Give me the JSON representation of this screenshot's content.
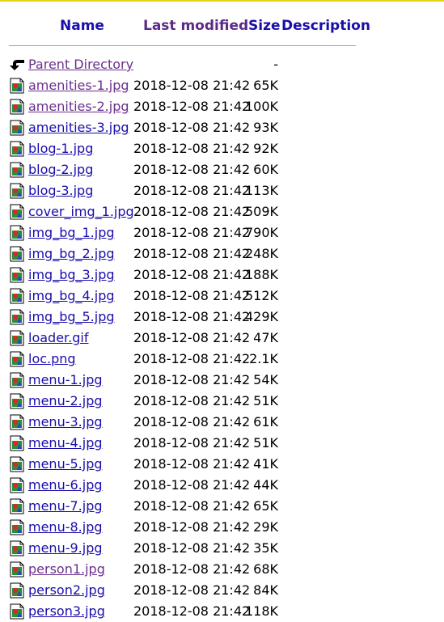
{
  "colors": {
    "link": "#1a0dab",
    "visited": "#6b2f8e",
    "top_bar": "#e5d319"
  },
  "header": {
    "name": "Name",
    "last_modified": "Last modified",
    "size": "Size",
    "description": "Description"
  },
  "parent": {
    "label": "Parent Directory",
    "size": "-",
    "icon": "back-arrow-icon"
  },
  "files": [
    {
      "name": "amenities-1.jpg",
      "date": "2018-12-08 21:42",
      "size": "65K",
      "visited": true
    },
    {
      "name": "amenities-2.jpg",
      "date": "2018-12-08 21:42",
      "size": "100K",
      "visited": true
    },
    {
      "name": "amenities-3.jpg",
      "date": "2018-12-08 21:42",
      "size": "93K",
      "visited": false
    },
    {
      "name": "blog-1.jpg",
      "date": "2018-12-08 21:42",
      "size": "92K",
      "visited": false
    },
    {
      "name": "blog-2.jpg",
      "date": "2018-12-08 21:42",
      "size": "60K",
      "visited": false
    },
    {
      "name": "blog-3.jpg",
      "date": "2018-12-08 21:42",
      "size": "113K",
      "visited": false
    },
    {
      "name": "cover_img_1.jpg",
      "date": "2018-12-08 21:42",
      "size": "509K",
      "visited": false
    },
    {
      "name": "img_bg_1.jpg",
      "date": "2018-12-08 21:42",
      "size": "790K",
      "visited": false
    },
    {
      "name": "img_bg_2.jpg",
      "date": "2018-12-08 21:42",
      "size": "248K",
      "visited": false
    },
    {
      "name": "img_bg_3.jpg",
      "date": "2018-12-08 21:42",
      "size": "188K",
      "visited": false
    },
    {
      "name": "img_bg_4.jpg",
      "date": "2018-12-08 21:42",
      "size": "512K",
      "visited": false
    },
    {
      "name": "img_bg_5.jpg",
      "date": "2018-12-08 21:42",
      "size": "429K",
      "visited": false
    },
    {
      "name": "loader.gif",
      "date": "2018-12-08 21:42",
      "size": "47K",
      "visited": false
    },
    {
      "name": "loc.png",
      "date": "2018-12-08 21:42",
      "size": "2.1K",
      "visited": false
    },
    {
      "name": "menu-1.jpg",
      "date": "2018-12-08 21:42",
      "size": "54K",
      "visited": false
    },
    {
      "name": "menu-2.jpg",
      "date": "2018-12-08 21:42",
      "size": "51K",
      "visited": false
    },
    {
      "name": "menu-3.jpg",
      "date": "2018-12-08 21:42",
      "size": "61K",
      "visited": false
    },
    {
      "name": "menu-4.jpg",
      "date": "2018-12-08 21:42",
      "size": "51K",
      "visited": false
    },
    {
      "name": "menu-5.jpg",
      "date": "2018-12-08 21:42",
      "size": "41K",
      "visited": false
    },
    {
      "name": "menu-6.jpg",
      "date": "2018-12-08 21:42",
      "size": "44K",
      "visited": false
    },
    {
      "name": "menu-7.jpg",
      "date": "2018-12-08 21:42",
      "size": "65K",
      "visited": false
    },
    {
      "name": "menu-8.jpg",
      "date": "2018-12-08 21:42",
      "size": "29K",
      "visited": false
    },
    {
      "name": "menu-9.jpg",
      "date": "2018-12-08 21:42",
      "size": "35K",
      "visited": false
    },
    {
      "name": "person1.jpg",
      "date": "2018-12-08 21:42",
      "size": "68K",
      "visited": true
    },
    {
      "name": "person2.jpg",
      "date": "2018-12-08 21:42",
      "size": "84K",
      "visited": false
    },
    {
      "name": "person3.jpg",
      "date": "2018-12-08 21:42",
      "size": "118K",
      "visited": false
    }
  ],
  "file_icon": "image-file-icon"
}
